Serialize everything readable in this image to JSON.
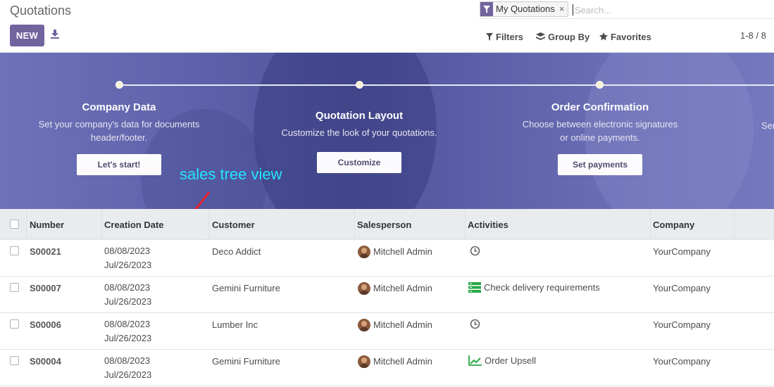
{
  "header": {
    "title": "Quotations",
    "new_label": "NEW",
    "facet_label": "My Quotations",
    "facet_close": "×",
    "search_placeholder": "Search...",
    "filters_label": "Filters",
    "groupby_label": "Group By",
    "favorites_label": "Favorites",
    "pager": "1-8 / 8"
  },
  "banner": {
    "steps": [
      {
        "title": "Company Data",
        "line1": "Set your company's data for documents",
        "line2": "header/footer.",
        "button": "Let's start!"
      },
      {
        "title": "Quotation Layout",
        "line1": "Customize the look of your quotations.",
        "line2": "",
        "button": "Customize"
      },
      {
        "title": "Order Confirmation",
        "line1": "Choose between electronic signatures",
        "line2": "or online payments.",
        "button": "Set payments"
      },
      {
        "title": "",
        "line1": "Ser",
        "line2": "",
        "button": ""
      }
    ],
    "annotation": "sales tree view",
    "annotation_color": "#23e5ff"
  },
  "table": {
    "columns": [
      "Number",
      "Creation Date",
      "Customer",
      "Salesperson",
      "Activities",
      "Company"
    ],
    "rows": [
      {
        "number": "S00021",
        "date1": "08/08/2023",
        "date2": "Jul/26/2023",
        "customer": "Deco Addict",
        "salesperson": "Mitchell Admin",
        "activity_icon": "clock-icon",
        "activity": "",
        "company": "YourCompany"
      },
      {
        "number": "S00007",
        "date1": "08/08/2023",
        "date2": "Jul/26/2023",
        "customer": "Gemini Furniture",
        "salesperson": "Mitchell Admin",
        "activity_icon": "list-icon",
        "activity": "Check delivery requirements",
        "company": "YourCompany"
      },
      {
        "number": "S00006",
        "date1": "08/08/2023",
        "date2": "Jul/26/2023",
        "customer": "Lumber Inc",
        "salesperson": "Mitchell Admin",
        "activity_icon": "clock-icon",
        "activity": "",
        "company": "YourCompany"
      },
      {
        "number": "S00004",
        "date1": "08/08/2023",
        "date2": "Jul/26/2023",
        "customer": "Gemini Furniture",
        "salesperson": "Mitchell Admin",
        "activity_icon": "chart-up-icon",
        "activity": "Order Upsell",
        "company": "YourCompany"
      }
    ]
  },
  "colors": {
    "brand": "#71639e",
    "activity_green": "#28a745"
  }
}
